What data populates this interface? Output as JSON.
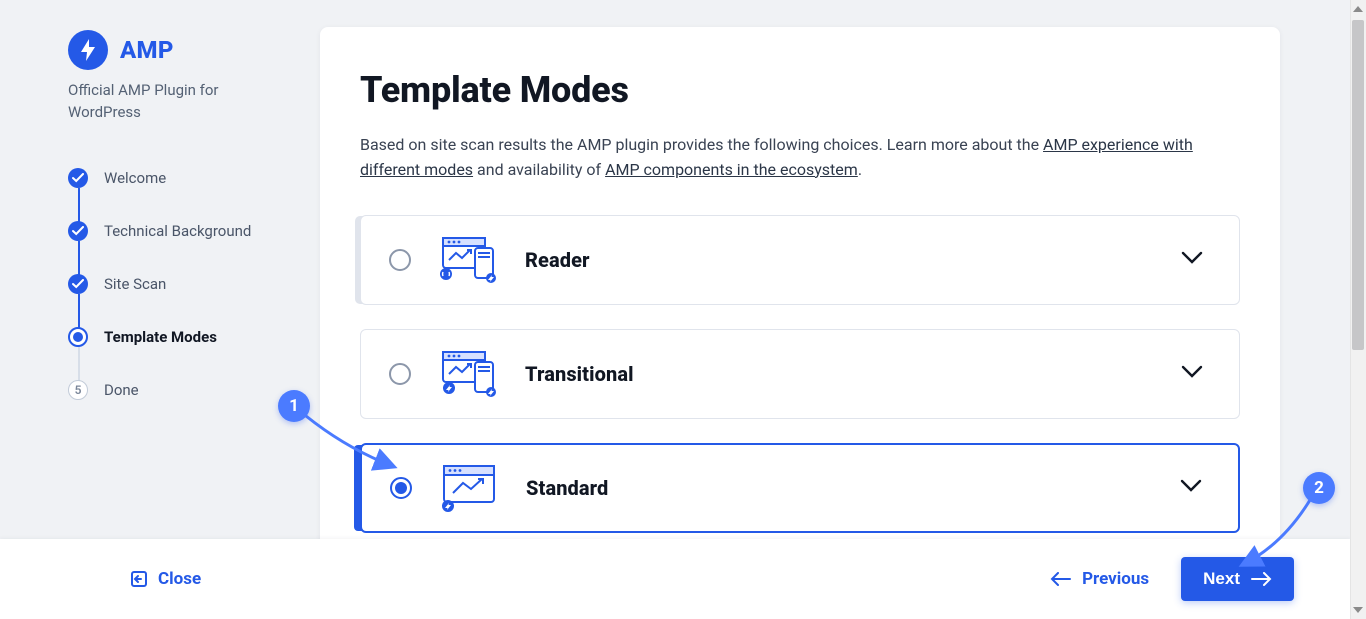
{
  "brand": {
    "title": "AMP",
    "subtitle": "Official AMP Plugin for WordPress"
  },
  "steps": [
    {
      "label": "Welcome",
      "state": "done"
    },
    {
      "label": "Technical Background",
      "state": "done"
    },
    {
      "label": "Site Scan",
      "state": "done"
    },
    {
      "label": "Template Modes",
      "state": "current"
    },
    {
      "label": "Done",
      "state": "pending",
      "index": "5"
    }
  ],
  "page": {
    "title": "Template Modes",
    "intro_pre": "Based on site scan results the AMP plugin provides the following choices. Learn more about the ",
    "intro_link1": "AMP experience with different modes",
    "intro_mid": " and availability of ",
    "intro_link2": "AMP components in the ecosystem",
    "intro_post": "."
  },
  "modes": [
    {
      "name": "Reader",
      "selected": false
    },
    {
      "name": "Transitional",
      "selected": false
    },
    {
      "name": "Standard",
      "selected": true
    }
  ],
  "footer": {
    "close": "Close",
    "previous": "Previous",
    "next": "Next"
  },
  "annotations": {
    "one": "1",
    "two": "2"
  }
}
